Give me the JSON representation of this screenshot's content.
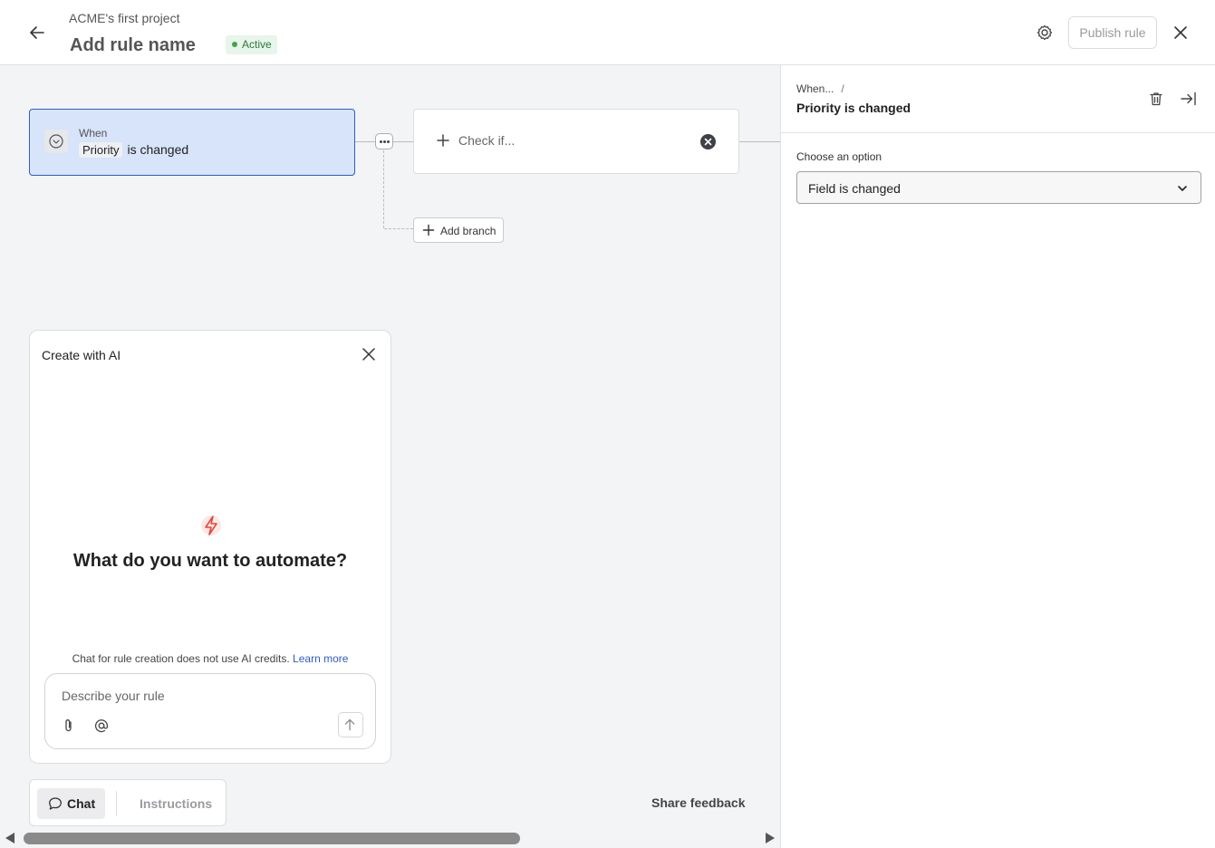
{
  "header": {
    "project_name": "ACME's first project",
    "rule_name": "Add rule name",
    "status": "Active",
    "publish_label": "Publish rule"
  },
  "canvas": {
    "trigger": {
      "when_label": "When",
      "field": "Priority",
      "condition_text": "is changed"
    },
    "check_card": {
      "label": "Check if..."
    },
    "add_branch_label": "Add branch"
  },
  "ai_panel": {
    "title": "Create with AI",
    "headline": "What do you want to automate?",
    "credits_text": "Chat for rule creation does not use AI credits.",
    "learn_more": "Learn more",
    "input_placeholder": "Describe your rule"
  },
  "bottom_bar": {
    "tab_chat": "Chat",
    "tab_instructions": "Instructions",
    "share_feedback": "Share feedback"
  },
  "side_panel": {
    "breadcrumb": "When...",
    "breadcrumb_separator": "/",
    "title": "Priority is changed",
    "option_label": "Choose an option",
    "option_value": "Field is changed"
  },
  "colors": {
    "trigger_bg": "#d7e4f9",
    "trigger_border": "#2f5ec4",
    "status_green": "#3da550",
    "ai_bolt": "#e2483d",
    "link": "#2f5ec4"
  },
  "icons": [
    "back-arrow-icon",
    "gear-icon",
    "close-icon",
    "chevron-down-icon",
    "more-icon",
    "plus-icon",
    "clear-icon",
    "bolt-icon",
    "paperclip-icon",
    "at-icon",
    "arrow-up-icon",
    "chat-bubble-icon",
    "trash-icon",
    "collapse-panel-icon"
  ]
}
